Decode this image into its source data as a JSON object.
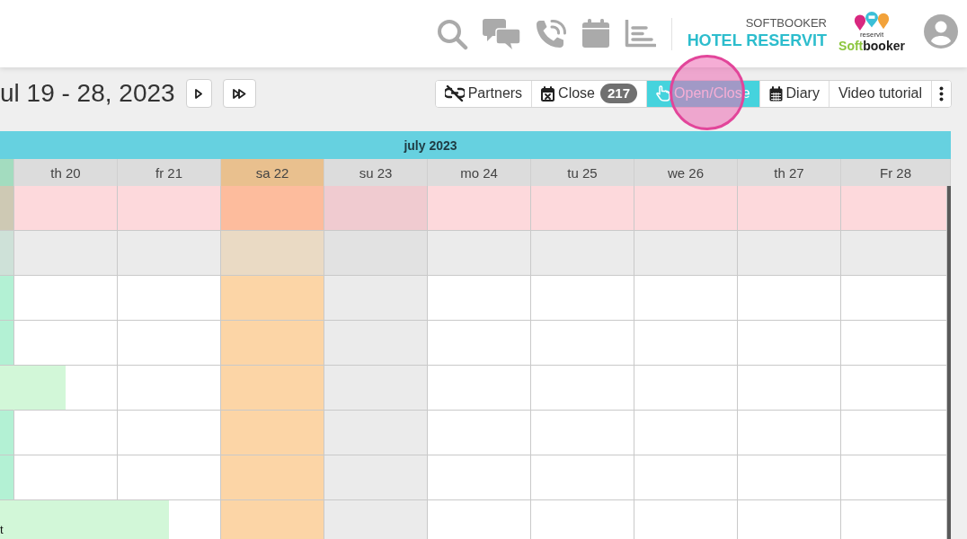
{
  "header": {
    "brand": {
      "kicker": "SOFTBOOKER",
      "name": "HOTEL RESERVIT"
    },
    "logo": {
      "tagline": "reservit",
      "wordmark": [
        {
          "text": "Soft",
          "color": "#8cc63e"
        },
        {
          "text": "booker",
          "color": "#1e1e1e"
        }
      ]
    }
  },
  "period": {
    "title": "ul 19 - 28, 2023"
  },
  "toolbar": [
    {
      "label": "Partners",
      "selected": false
    },
    {
      "label": "Close",
      "badge": "217",
      "selected": false
    },
    {
      "label": "Open/Close",
      "selected": true
    },
    {
      "label": "Diary",
      "selected": false
    },
    {
      "label": "Video tutorial",
      "selected": false
    }
  ],
  "calendar": {
    "month": "july 2023",
    "days": [
      {
        "kind": "today"
      },
      {
        "label": "th 20",
        "kind": "weekday"
      },
      {
        "label": "fr 21",
        "kind": "weekday"
      },
      {
        "label": "sa 22",
        "kind": "saturday"
      },
      {
        "label": "su 23",
        "kind": "sunday"
      },
      {
        "label": "mo 24",
        "kind": "weekday"
      },
      {
        "label": "tu 25",
        "kind": "weekday"
      },
      {
        "label": "we 26",
        "kind": "weekday"
      },
      {
        "label": "th 27",
        "kind": "weekday"
      },
      {
        "label": "Fr 28",
        "kind": "weekday"
      }
    ],
    "rows": [
      {
        "kind": "closed"
      },
      {
        "kind": "summary"
      },
      {
        "kind": "room"
      },
      {
        "kind": "room"
      },
      {
        "kind": "room",
        "cells": [
          {
            "booked": true,
            "departure": false
          },
          {
            "booked": true,
            "departure": true
          }
        ]
      },
      {
        "kind": "room"
      },
      {
        "kind": "room"
      },
      {
        "kind": "room",
        "cells": [
          {
            "booked": true,
            "departure": false,
            "label": "t"
          },
          {
            "booked": true,
            "departure": false
          },
          {
            "booked": true,
            "departure": true
          }
        ]
      }
    ]
  }
}
